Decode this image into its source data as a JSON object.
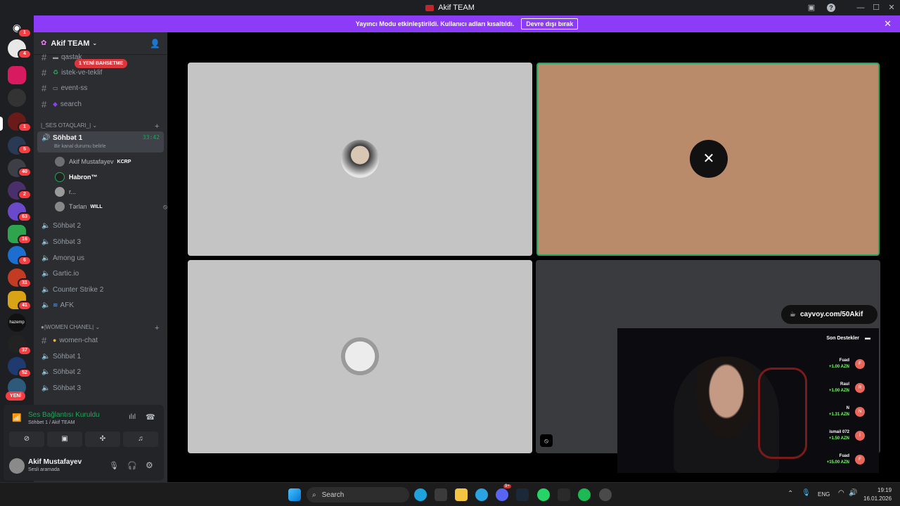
{
  "window": {
    "title": "Akif TEAM"
  },
  "banner": {
    "text": "Yayıncı Modu etkinleştirildi. Kullanıcı adları kısaltıldı.",
    "button": "Devre dışı bırak"
  },
  "servers": {
    "badges": [
      "1",
      "4",
      "1",
      "5",
      "40",
      "2",
      "63",
      "16",
      "6",
      "31",
      "41",
      "37",
      "52"
    ],
    "new_label": "YENİ"
  },
  "server_header": {
    "name": "Akif TEAM"
  },
  "mention": "1 YENİ BAHSETME",
  "channels": [
    {
      "name": "qastak",
      "emoji": "📁"
    },
    {
      "name": "istek-ve-teklif",
      "emoji": "♻"
    },
    {
      "name": "event-ss",
      "emoji": "📷"
    },
    {
      "name": "search",
      "emoji": "🎮"
    }
  ],
  "voice_category": "|_SES OTAQLARI_|",
  "active_voice": {
    "name": "Söhbət 1",
    "timer": "33:42",
    "status_hint": "Bir kanal durumu belirle"
  },
  "voice_users": [
    {
      "name": "Akif Mustafayev",
      "tag": "KCRP"
    },
    {
      "name": "Habron™",
      "tag": ""
    },
    {
      "name": "r...",
      "tag": ""
    },
    {
      "name": "Tərlan",
      "tag": "WILL"
    }
  ],
  "voice_channels": [
    "Söhbət 2",
    "Söhbət 3",
    "Among us",
    "Gartic.io",
    "Counter Strike 2",
    "AFK"
  ],
  "women_category": "|WOMEN CHANEL|",
  "women_channels": [
    {
      "name": "women-chat",
      "type": "text"
    },
    {
      "name": "Söhbət 1",
      "type": "voice"
    },
    {
      "name": "Söhbət 2",
      "type": "voice"
    },
    {
      "name": "Söhbət 3",
      "type": "voice"
    }
  ],
  "voice_status": {
    "title": "Ses Bağlantısı Kuruldu",
    "subtitle": "Söhbet 1 / Akif TEAM"
  },
  "user": {
    "name": "Akif Mustafayev",
    "status": "Sesli aramada"
  },
  "stream": {
    "link": "cayvoy.com/50Akif",
    "recent_title": "Son Destekler",
    "donations": [
      {
        "name": "Fuad",
        "amount": "+1.00 AZN",
        "initial": "F"
      },
      {
        "name": "Raul",
        "amount": "+1.00 AZN",
        "initial": "R"
      },
      {
        "name": "N",
        "amount": "+1.31 AZN",
        "initial": "N"
      },
      {
        "name": "ismail 072",
        "amount": "+1.50 AZN",
        "initial": "İ"
      },
      {
        "name": "Fuad",
        "amount": "+15.00 AZN",
        "initial": "F"
      }
    ]
  },
  "taskbar": {
    "search": "Search",
    "lang": "ENG",
    "time": "19:19",
    "date": "16.01.2026",
    "discord_badge": "9+"
  },
  "colors": {
    "accent": "#8c3cf6",
    "speaking": "#23a55a",
    "tile_gray": "#c4c4c4",
    "tile_tan": "#b98b6a"
  }
}
